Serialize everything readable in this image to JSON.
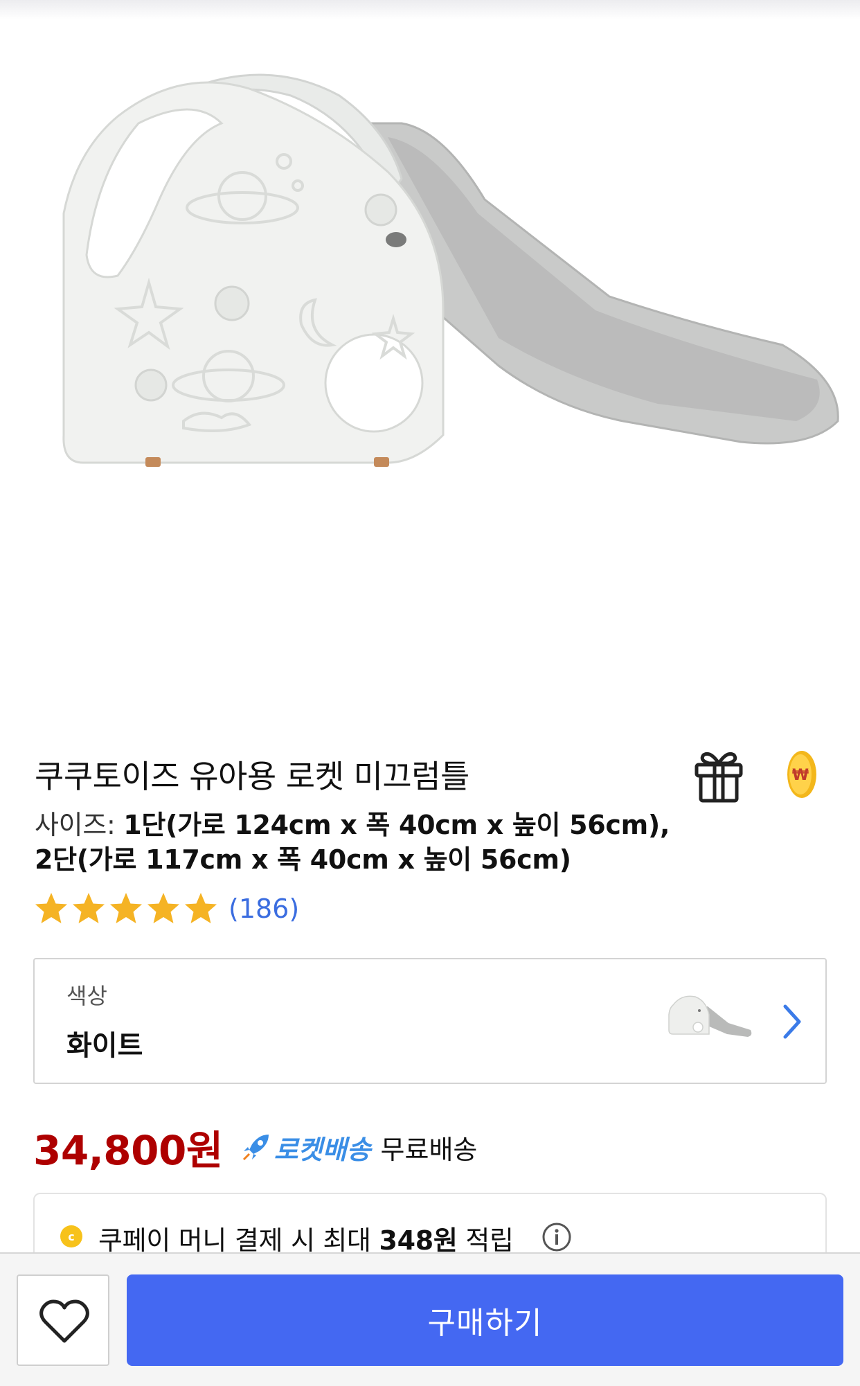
{
  "product": {
    "title": "쿠쿠토이즈 유아용 로켓 미끄럼틀",
    "size_label": "사이즈:",
    "size_line1": "1단(가로 124cm x 폭 40cm x 높이 56cm),",
    "size_line2": "2단(가로 117cm x 폭 40cm x 높이 56cm)",
    "rating_stars": 5,
    "review_count": "(186)"
  },
  "option": {
    "label": "색상",
    "value": "화이트"
  },
  "price": {
    "amount": "34,800원",
    "rocket_label": "로켓배송",
    "shipping": "무료배송"
  },
  "coupay": {
    "text_prefix": "쿠페이 머니 결제 시 최대 ",
    "amount": "348원",
    "text_suffix": " 적립"
  },
  "bottom_bar": {
    "buy_label": "구매하기"
  },
  "colors": {
    "price": "#ae0000",
    "link_blue": "#3b6de0",
    "buy_button": "#4468f2",
    "star": "#f5b324"
  },
  "icons": [
    "gift-icon",
    "coin-icon",
    "star-icon",
    "chevron-right-icon",
    "rocket-icon",
    "info-icon",
    "heart-icon"
  ]
}
